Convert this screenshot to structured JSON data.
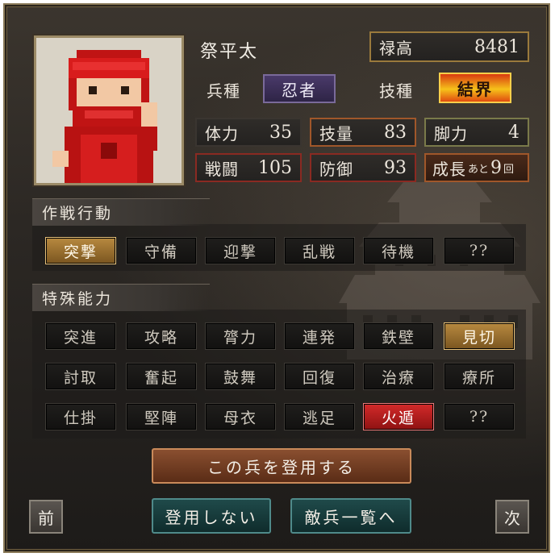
{
  "character": {
    "name": "祭平太",
    "salary_label": "禄高",
    "salary_value": "8481",
    "troop_type_label": "兵種",
    "troop_type_value": "忍者",
    "skill_type_label": "技種",
    "skill_type_value": "結界"
  },
  "stats": {
    "hp_label": "体力",
    "hp_value": "35",
    "skill_label": "技量",
    "skill_value": "83",
    "leg_label": "脚力",
    "leg_value": "4",
    "combat_label": "戦闘",
    "combat_value": "105",
    "defense_label": "防御",
    "defense_value": "93",
    "growth_label": "成長",
    "growth_sub": "あと",
    "growth_value": "9",
    "growth_unit": "回"
  },
  "tactics": {
    "title": "作戦行動",
    "items": [
      {
        "label": "突撃",
        "selected": true
      },
      {
        "label": "守備",
        "selected": false
      },
      {
        "label": "迎撃",
        "selected": false
      },
      {
        "label": "乱戦",
        "selected": false
      },
      {
        "label": "待機",
        "selected": false
      },
      {
        "label": "??",
        "selected": false
      }
    ]
  },
  "abilities": {
    "title": "特殊能力",
    "rows": [
      [
        {
          "label": "突進",
          "state": "off"
        },
        {
          "label": "攻略",
          "state": "off"
        },
        {
          "label": "膂力",
          "state": "off"
        },
        {
          "label": "連発",
          "state": "off"
        },
        {
          "label": "鉄壁",
          "state": "off"
        },
        {
          "label": "見切",
          "state": "gold"
        }
      ],
      [
        {
          "label": "討取",
          "state": "off"
        },
        {
          "label": "奮起",
          "state": "off"
        },
        {
          "label": "鼓舞",
          "state": "off"
        },
        {
          "label": "回復",
          "state": "off"
        },
        {
          "label": "治療",
          "state": "off"
        },
        {
          "label": "療所",
          "state": "off"
        }
      ],
      [
        {
          "label": "仕掛",
          "state": "off"
        },
        {
          "label": "堅陣",
          "state": "off"
        },
        {
          "label": "母衣",
          "state": "off"
        },
        {
          "label": "逃足",
          "state": "off"
        },
        {
          "label": "火遁",
          "state": "red"
        },
        {
          "label": "??",
          "state": "off"
        }
      ]
    ]
  },
  "actions": {
    "recruit": "この兵を登用する",
    "decline": "登用しない",
    "enemy_list": "敵兵一覧へ",
    "prev": "前",
    "next": "次"
  },
  "colors": {
    "selected_gold": "#b88a40",
    "selected_red": "#d42a2a",
    "ninja_purple": "#4a3a6a",
    "teal_button": "#1f4a4a",
    "recruit_brown": "#8a4f30"
  }
}
